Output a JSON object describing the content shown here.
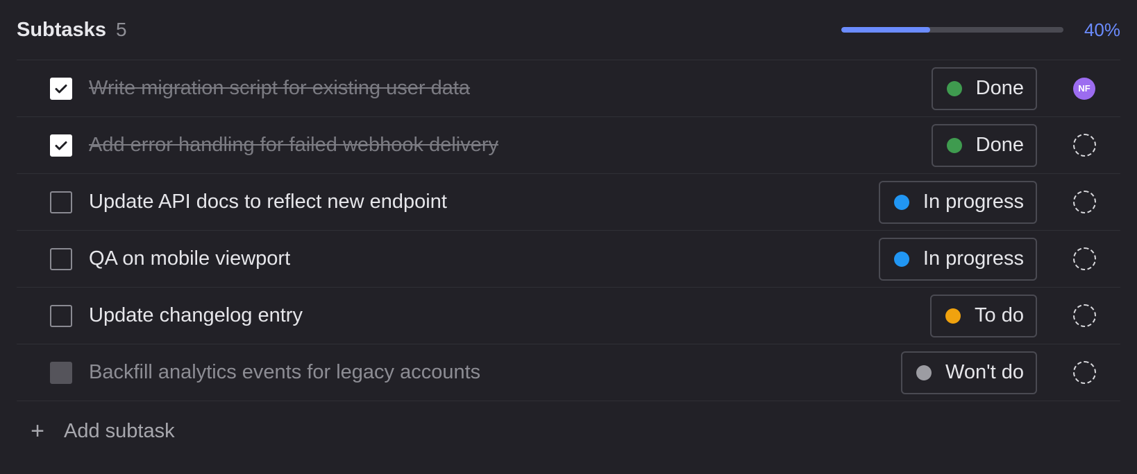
{
  "header": {
    "title": "Subtasks",
    "count": "5",
    "progress_label": "40%",
    "progress_fraction": 0.4,
    "accent_color": "#6b8cff"
  },
  "subtasks": [
    {
      "text": "Write migration script for existing user data",
      "checked": true,
      "state": "done",
      "status": "Done",
      "status_color": "#3f9b4f",
      "assignee": "NF"
    },
    {
      "text": "Add error handling for failed webhook delivery",
      "checked": true,
      "state": "done",
      "status": "Done",
      "status_color": "#3f9b4f",
      "assignee": ""
    },
    {
      "text": "Update API docs to reflect new endpoint",
      "checked": false,
      "state": "open",
      "status": "In progress",
      "status_color": "#2196f3",
      "assignee": ""
    },
    {
      "text": "QA on mobile viewport",
      "checked": false,
      "state": "open",
      "status": "In progress",
      "status_color": "#2196f3",
      "assignee": ""
    },
    {
      "text": "Update changelog entry",
      "checked": false,
      "state": "open",
      "status": "To do",
      "status_color": "#f0a20e",
      "assignee": ""
    },
    {
      "text": "Backfill analytics events for legacy accounts",
      "checked": false,
      "state": "wontdo",
      "status": "Won't do",
      "status_color": "#9c9ca2",
      "assignee": ""
    }
  ],
  "add": {
    "label": "Add subtask",
    "icon": "plus-icon"
  },
  "icons": {
    "check": "check-icon",
    "status_dot": "status-dot-icon",
    "unassigned": "unassigned-avatar-icon"
  }
}
